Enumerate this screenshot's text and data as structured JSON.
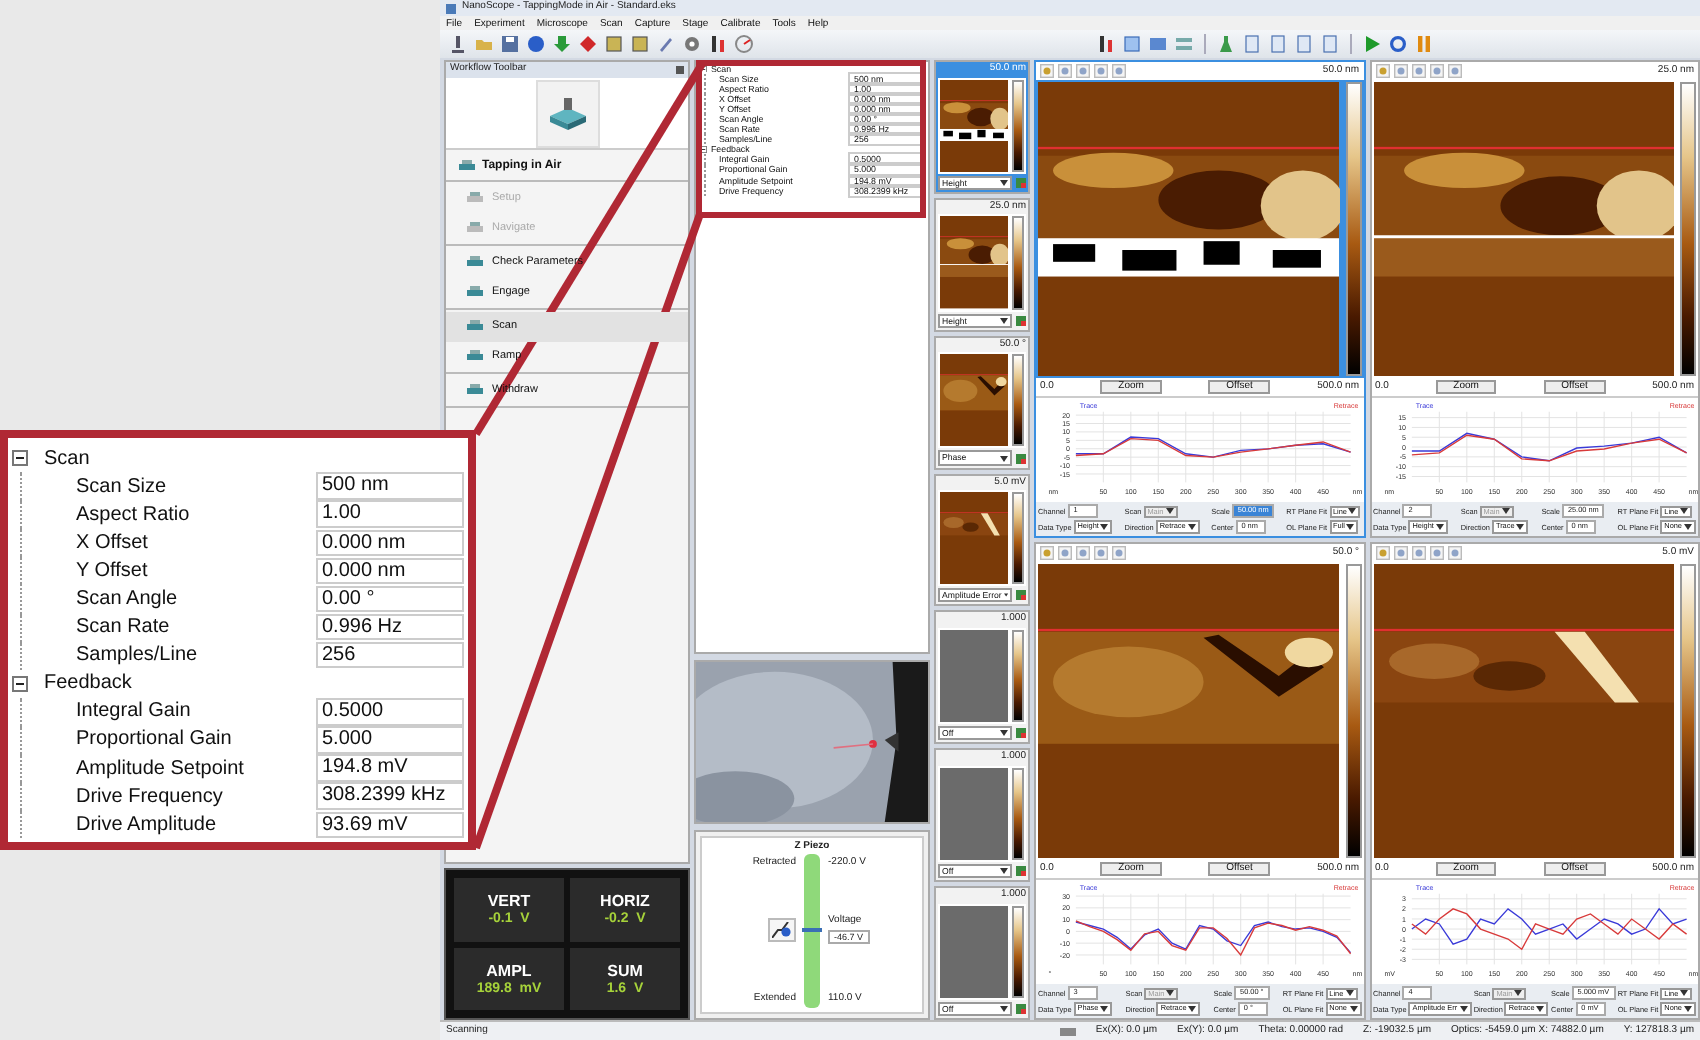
{
  "window": {
    "title": "NanoScope - TappingMode in Air - Standard.eks"
  },
  "menu": [
    "File",
    "Experiment",
    "Microscope",
    "Scan",
    "Capture",
    "Stage",
    "Calibrate",
    "Tools",
    "Help"
  ],
  "workflow": {
    "title": "Workflow Toolbar",
    "mode": "Tapping in Air",
    "groups": [
      {
        "items": [
          {
            "label": "Setup",
            "disabled": true,
            "selected": false
          },
          {
            "label": "Navigate",
            "disabled": true,
            "selected": false
          }
        ]
      },
      {
        "items": [
          {
            "label": "Check Parameters",
            "disabled": false,
            "selected": false
          },
          {
            "label": "Engage",
            "disabled": false,
            "selected": false
          }
        ]
      },
      {
        "items": [
          {
            "label": "Scan",
            "disabled": false,
            "selected": true
          },
          {
            "label": "Ramp",
            "disabled": false,
            "selected": false
          }
        ]
      },
      {
        "items": [
          {
            "label": "Withdraw",
            "disabled": false,
            "selected": false
          }
        ]
      }
    ]
  },
  "meters": [
    {
      "label": "VERT",
      "reading": "-0.1  V"
    },
    {
      "label": "HORIZ",
      "reading": "-0.2  V"
    },
    {
      "label": "AMPL",
      "reading": "189.8  mV"
    },
    {
      "label": "SUM",
      "reading": "1.6  V"
    }
  ],
  "parameters": {
    "groups": [
      {
        "label": "Scan",
        "expanded": true,
        "children": [
          {
            "label": "Scan Size",
            "value": "500 nm"
          },
          {
            "label": "Aspect Ratio",
            "value": "1.00"
          },
          {
            "label": "X Offset",
            "value": "0.000 nm"
          },
          {
            "label": "Y Offset",
            "value": "0.000 nm"
          },
          {
            "label": "Scan Angle",
            "value": "0.00 °"
          },
          {
            "label": "Scan Rate",
            "value": "0.996 Hz"
          },
          {
            "label": "Samples/Line",
            "value": "256"
          }
        ]
      },
      {
        "label": "Feedback",
        "expanded": true,
        "children": [
          {
            "label": "Integral Gain",
            "value": "0.5000"
          },
          {
            "label": "Proportional Gain",
            "value": "5.000"
          },
          {
            "label": "Amplitude Setpoint",
            "value": "194.8 mV"
          },
          {
            "label": "Drive Frequency",
            "value": "308.2399 kHz"
          }
        ]
      }
    ]
  },
  "callout": {
    "groups": [
      {
        "label": "Scan",
        "expanded": true,
        "children": [
          {
            "label": "Scan Size",
            "value": "500 nm"
          },
          {
            "label": "Aspect Ratio",
            "value": "1.00"
          },
          {
            "label": "X Offset",
            "value": "0.000 nm"
          },
          {
            "label": "Y Offset",
            "value": "0.000 nm"
          },
          {
            "label": "Scan Angle",
            "value": "0.00 °"
          },
          {
            "label": "Scan Rate",
            "value": "0.996 Hz"
          },
          {
            "label": "Samples/Line",
            "value": "256"
          }
        ]
      },
      {
        "label": "Feedback",
        "expanded": true,
        "children": [
          {
            "label": "Integral Gain",
            "value": "0.5000"
          },
          {
            "label": "Proportional Gain",
            "value": "5.000"
          },
          {
            "label": "Amplitude Setpoint",
            "value": "194.8 mV"
          },
          {
            "label": "Drive Frequency",
            "value": "308.2399 kHz"
          },
          {
            "label": "Drive Amplitude",
            "value": "93.69 mV"
          }
        ]
      }
    ]
  },
  "z_piezo": {
    "title": "Z Piezo",
    "top_label": "Retracted",
    "top_value": "-220.0 V",
    "voltage_label": "Voltage",
    "voltage": "-46.7 V",
    "bottom_label": "Extended",
    "bottom_value": "110.0 V",
    "level": 0.52
  },
  "thumbnails": [
    {
      "scale": "50.0 nm",
      "channel": "Height",
      "selected": true
    },
    {
      "scale": "25.0 nm",
      "channel": "Height",
      "selected": false
    },
    {
      "scale": "50.0 °",
      "channel": "Phase",
      "selected": false
    },
    {
      "scale": "5.0 mV",
      "channel": "Amplitude Error",
      "selected": false
    },
    {
      "scale": "1.000",
      "channel": "Off",
      "kind": "empty",
      "selected": false
    },
    {
      "scale": "1.000",
      "channel": "Off",
      "kind": "empty",
      "selected": false
    },
    {
      "scale": "1.000",
      "channel": "Off",
      "kind": "empty",
      "selected": false
    }
  ],
  "panels": [
    {
      "scale": "50.0 nm",
      "min": "0.0",
      "max": "500.0 nm",
      "selected": true,
      "zoom": "Zoom",
      "offset": "Offset",
      "controls": [
        {
          "label": "Channel",
          "value": "1",
          "kind": "field"
        },
        {
          "label": "Scan",
          "value": "Main",
          "kind": "select",
          "disabled": true
        },
        {
          "label": "Scale",
          "value": "50.00 nm",
          "kind": "field",
          "selected": true
        },
        {
          "label": "RT Plane Fit",
          "value": "Line",
          "kind": "select",
          "disabled": false
        },
        {
          "label": "Data Type",
          "value": "Height",
          "kind": "select",
          "disabled": false
        },
        {
          "label": "Direction",
          "value": "Retrace",
          "kind": "select",
          "disabled": false
        },
        {
          "label": "Center",
          "value": "0 nm",
          "kind": "field",
          "selected": false
        },
        {
          "label": "OL Plane Fit",
          "value": "Full",
          "kind": "select",
          "disabled": false
        }
      ],
      "chart_data": {
        "type": "line",
        "grid": true,
        "xlabel": "nm",
        "ylabel": "nm",
        "x": [
          0,
          50,
          100,
          150,
          200,
          250,
          300,
          350,
          400,
          450,
          500
        ],
        "xlim": [
          0,
          500
        ],
        "ylim": [
          -20,
          22
        ],
        "xticks": [
          50,
          100,
          150,
          200,
          250,
          300,
          350,
          400,
          450
        ],
        "yticks": [
          -15,
          -10,
          -5,
          0,
          5,
          10,
          15,
          20
        ],
        "series": [
          {
            "name": "Trace",
            "color": "#3a3ad8",
            "values": [
              -3,
              -3,
              7,
              6,
              -3,
              -5,
              -1,
              0,
              2,
              3,
              -2
            ]
          },
          {
            "name": "Retrace",
            "color": "#d83a3a",
            "values": [
              -4,
              -3,
              6,
              5,
              -4,
              -5,
              -2,
              0,
              2,
              4,
              -2
            ]
          }
        ]
      }
    },
    {
      "scale": "25.0 nm",
      "min": "0.0",
      "max": "500.0 nm",
      "selected": false,
      "zoom": "Zoom",
      "offset": "Offset",
      "controls": [
        {
          "label": "Channel",
          "value": "2",
          "kind": "field"
        },
        {
          "label": "Scan",
          "value": "Main",
          "kind": "select",
          "disabled": true
        },
        {
          "label": "Scale",
          "value": "25.00 nm",
          "kind": "field",
          "selected": false
        },
        {
          "label": "RT Plane Fit",
          "value": "Line",
          "kind": "select",
          "disabled": false
        },
        {
          "label": "Data Type",
          "value": "Height",
          "kind": "select",
          "disabled": false
        },
        {
          "label": "Direction",
          "value": "Trace",
          "kind": "select",
          "disabled": false
        },
        {
          "label": "Center",
          "value": "0 nm",
          "kind": "field",
          "selected": false
        },
        {
          "label": "OL Plane Fit",
          "value": "None",
          "kind": "select",
          "disabled": false
        }
      ],
      "chart_data": {
        "type": "line",
        "grid": true,
        "xlabel": "nm",
        "ylabel": "nm",
        "x": [
          0,
          50,
          100,
          150,
          200,
          250,
          300,
          350,
          400,
          450,
          500
        ],
        "xlim": [
          0,
          500
        ],
        "ylim": [
          -18,
          18
        ],
        "xticks": [
          50,
          100,
          150,
          200,
          250,
          300,
          350,
          400,
          450
        ],
        "yticks": [
          -15,
          -10,
          -5,
          0,
          5,
          10,
          15
        ],
        "series": [
          {
            "name": "Trace",
            "color": "#3a3ad8",
            "values": [
              -2,
              -2,
              7,
              4,
              -5,
              -7,
              -0.5,
              0.5,
              2,
              5,
              -3
            ]
          },
          {
            "name": "Retrace",
            "color": "#d83a3a",
            "values": [
              -4,
              -3,
              6,
              4,
              -6,
              -7,
              -2,
              -1,
              2,
              4,
              -3
            ]
          }
        ]
      }
    },
    {
      "scale": "50.0 °",
      "min": "0.0",
      "max": "500.0 nm",
      "selected": false,
      "zoom": "Zoom",
      "offset": "Offset",
      "controls": [
        {
          "label": "Channel",
          "value": "3",
          "kind": "field"
        },
        {
          "label": "Scan",
          "value": "Main",
          "kind": "select",
          "disabled": true
        },
        {
          "label": "Scale",
          "value": "50.00 °",
          "kind": "field",
          "selected": false
        },
        {
          "label": "RT Plane Fit",
          "value": "Line",
          "kind": "select",
          "disabled": false
        },
        {
          "label": "Data Type",
          "value": "Phase",
          "kind": "select",
          "disabled": false
        },
        {
          "label": "Direction",
          "value": "Retrace",
          "kind": "select",
          "disabled": false
        },
        {
          "label": "Center",
          "value": "0 °",
          "kind": "field",
          "selected": false
        },
        {
          "label": "OL Plane Fit",
          "value": "None",
          "kind": "select",
          "disabled": false
        }
      ],
      "chart_data": {
        "type": "line",
        "grid": true,
        "xlabel": "nm",
        "ylabel": "°",
        "x": [
          0,
          25,
          50,
          75,
          100,
          125,
          150,
          175,
          200,
          225,
          250,
          275,
          300,
          325,
          350,
          375,
          400,
          425,
          450,
          475,
          500
        ],
        "xlim": [
          0,
          500
        ],
        "ylim": [
          -28,
          32
        ],
        "xticks": [
          50,
          100,
          150,
          200,
          250,
          300,
          350,
          400,
          450
        ],
        "yticks": [
          -20,
          -10,
          0,
          10,
          20,
          30
        ],
        "series": [
          {
            "name": "Trace",
            "color": "#3a3ad8",
            "values": [
              8,
              5,
              2,
              -5,
              -15,
              -3,
              2,
              -10,
              -15,
              5,
              2,
              -8,
              -12,
              5,
              8,
              4,
              2,
              3,
              0,
              -5,
              -18
            ]
          },
          {
            "name": "Retrace",
            "color": "#d83a3a",
            "values": [
              9,
              4,
              0,
              -7,
              -16,
              -2,
              0,
              -12,
              -16,
              3,
              3,
              -6,
              -20,
              3,
              7,
              5,
              1,
              4,
              1,
              -4,
              -19
            ]
          }
        ]
      }
    },
    {
      "scale": "5.0 mV",
      "min": "0.0",
      "max": "500.0 nm",
      "selected": false,
      "zoom": "Zoom",
      "offset": "Offset",
      "controls": [
        {
          "label": "Channel",
          "value": "4",
          "kind": "field"
        },
        {
          "label": "Scan",
          "value": "Main",
          "kind": "select",
          "disabled": true
        },
        {
          "label": "Scale",
          "value": "5.000 mV",
          "kind": "field",
          "selected": false
        },
        {
          "label": "RT Plane Fit",
          "value": "Line",
          "kind": "select",
          "disabled": false
        },
        {
          "label": "Data Type",
          "value": "Amplitude Err",
          "kind": "select",
          "disabled": false
        },
        {
          "label": "Direction",
          "value": "Retrace",
          "kind": "select",
          "disabled": false
        },
        {
          "label": "Center",
          "value": "0 mV",
          "kind": "field",
          "selected": false
        },
        {
          "label": "OL Plane Fit",
          "value": "None",
          "kind": "select",
          "disabled": false
        }
      ],
      "chart_data": {
        "type": "line",
        "grid": true,
        "xlabel": "nm",
        "ylabel": "mV",
        "x": [
          0,
          25,
          50,
          75,
          100,
          125,
          150,
          175,
          200,
          225,
          250,
          275,
          300,
          325,
          350,
          375,
          400,
          425,
          450,
          475,
          500
        ],
        "xlim": [
          0,
          500
        ],
        "ylim": [
          -3.5,
          3.5
        ],
        "xticks": [
          50,
          100,
          150,
          200,
          250,
          300,
          350,
          400,
          450
        ],
        "yticks": [
          -3,
          -2,
          -1,
          0,
          1,
          2,
          3
        ],
        "series": [
          {
            "name": "Trace",
            "color": "#3a3ad8",
            "values": [
              0,
              1,
              0.5,
              -1.5,
              -1,
              1,
              0.5,
              2,
              1,
              -0.5,
              0,
              0.5,
              -1,
              0,
              1,
              0.5,
              -0.5,
              0,
              2,
              0.5,
              1
            ]
          },
          {
            "name": "Retrace",
            "color": "#d83a3a",
            "values": [
              0.5,
              -0.5,
              1,
              2,
              1.5,
              0,
              -0.5,
              -1,
              -2,
              0.5,
              0,
              -0.5,
              1,
              1.5,
              0.5,
              -0.5,
              1,
              0,
              -1,
              0.5,
              -0.5
            ]
          }
        ]
      }
    }
  ],
  "status_bar": {
    "left": "Scanning",
    "items": [
      "Ex(X): 0.0 µm",
      "Ex(Y): 0.0 µm",
      "Theta: 0.00000 rad",
      "Z: -19032.5 µm",
      "Optics: -5459.0 µm  X: 74882.0 µm",
      "Y: 127818.3 µm"
    ]
  }
}
